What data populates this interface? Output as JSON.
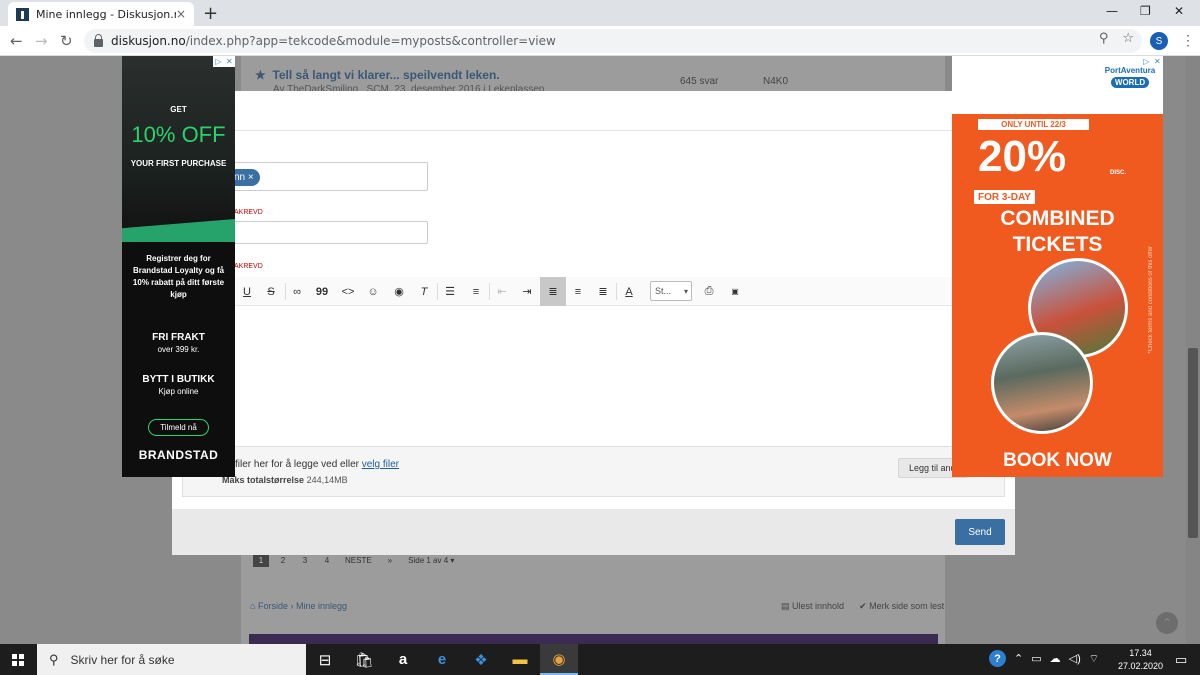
{
  "browser": {
    "tab_title": "Mine innlegg - Diskusjon.no",
    "tab_close": "×",
    "new_tab": "+",
    "url_domain": "diskusjon.no",
    "url_path": "/index.php?app=tekcode&module=myposts&controller=view",
    "profile_initial": "S",
    "window_controls": [
      "—",
      "❐",
      "✕"
    ]
  },
  "forum": {
    "thread_title": "Tell så langt vi klarer... speilvendt leken.",
    "thread_meta": "Av TheDarkSmiling , SCM, 23. desember 2016 i Lekeplassen",
    "replies": "645 svar",
    "last_user": "N4K0",
    "pages": [
      "1",
      "2",
      "3",
      "4"
    ],
    "next": "NESTE",
    "last": "»",
    "page_of": "Side 1 av 4 ▾",
    "crumb_home": "Forside",
    "crumb_sep": "›",
    "crumb_current": "Mine innlegg",
    "unread": "Ulest innhold",
    "mark_read": "Merk side som lest"
  },
  "modal": {
    "tag_label": "nn ×",
    "required_1": "AKREVD",
    "required_2": "AKREVD",
    "toolbar": {
      "underline": "U",
      "strike": "S",
      "quote": "99",
      "code": "<>",
      "style_select": "St..."
    },
    "upload_text": "filer her for å legge ved eller",
    "upload_link": "velg filer",
    "max_label": "Maks totalstørrelse",
    "max_value": "244,14MB",
    "add_button": "Legg til and",
    "send_button": "Send"
  },
  "ad_left": {
    "get": "GET",
    "off": "10% OFF",
    "first": "YOUR FIRST PURCHASE",
    "loyalty": "Registrer deg for Brandstad Loyalty og få 10% rabatt på ditt første kjøp",
    "frakt": "FRI FRAKT",
    "frakt_sub": "over 399 kr.",
    "bytt": "BYTT I BUTIKK",
    "bytt_sub": "Kjøp online",
    "button": "Tilmeld nå",
    "brand": "BRANDSTAD"
  },
  "ad_right": {
    "logo_top": "PortAventura",
    "logo_world": "WORLD",
    "until": "ONLY UNTIL 22/3",
    "percent": "20%",
    "disc": "DISC.",
    "days": "FOR 3-DAY",
    "combined": "COMBINED",
    "tickets": "TICKETS",
    "terms": "*Check terms and conditions of this offer",
    "book": "BOOK NOW"
  },
  "taskbar": {
    "search_placeholder": "Skriv her for å søke",
    "time": "17.34",
    "date": "27.02.2020"
  }
}
